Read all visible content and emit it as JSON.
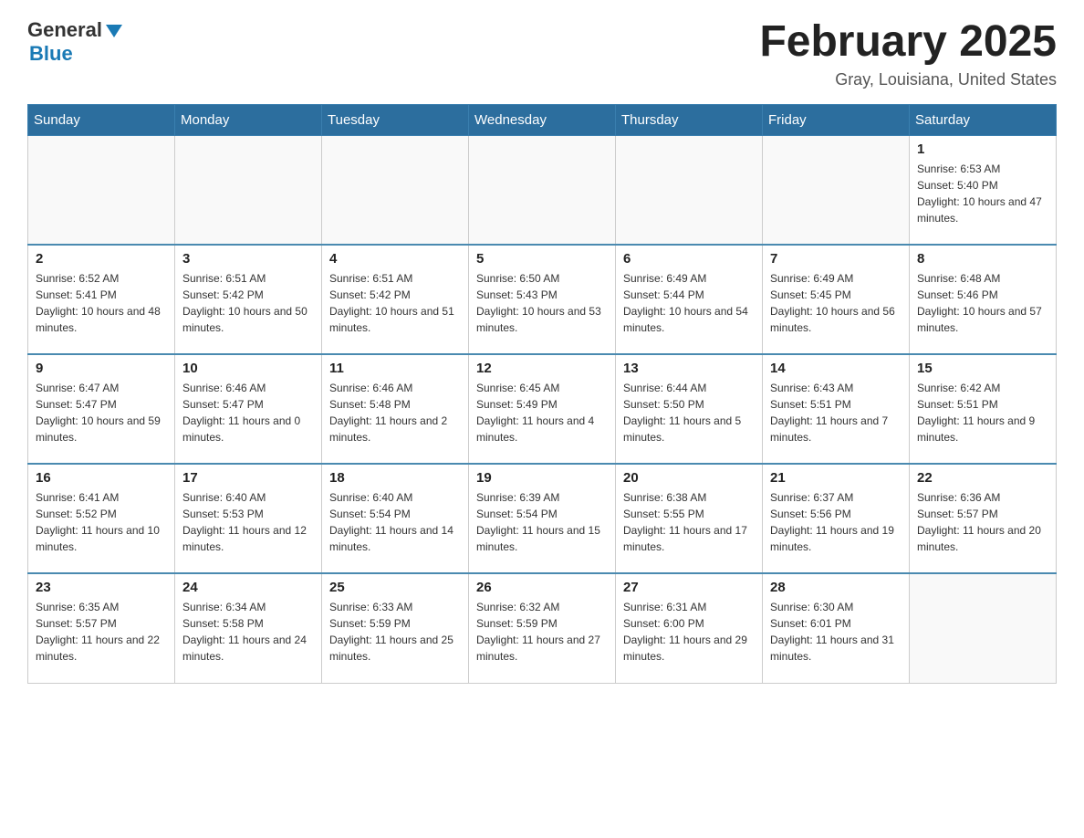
{
  "header": {
    "logo": {
      "general": "General",
      "blue": "Blue",
      "triangle": "▶"
    },
    "title": "February 2025",
    "location": "Gray, Louisiana, United States"
  },
  "calendar": {
    "days_of_week": [
      "Sunday",
      "Monday",
      "Tuesday",
      "Wednesday",
      "Thursday",
      "Friday",
      "Saturday"
    ],
    "weeks": [
      [
        {
          "day": "",
          "info": ""
        },
        {
          "day": "",
          "info": ""
        },
        {
          "day": "",
          "info": ""
        },
        {
          "day": "",
          "info": ""
        },
        {
          "day": "",
          "info": ""
        },
        {
          "day": "",
          "info": ""
        },
        {
          "day": "1",
          "info": "Sunrise: 6:53 AM\nSunset: 5:40 PM\nDaylight: 10 hours and 47 minutes."
        }
      ],
      [
        {
          "day": "2",
          "info": "Sunrise: 6:52 AM\nSunset: 5:41 PM\nDaylight: 10 hours and 48 minutes."
        },
        {
          "day": "3",
          "info": "Sunrise: 6:51 AM\nSunset: 5:42 PM\nDaylight: 10 hours and 50 minutes."
        },
        {
          "day": "4",
          "info": "Sunrise: 6:51 AM\nSunset: 5:42 PM\nDaylight: 10 hours and 51 minutes."
        },
        {
          "day": "5",
          "info": "Sunrise: 6:50 AM\nSunset: 5:43 PM\nDaylight: 10 hours and 53 minutes."
        },
        {
          "day": "6",
          "info": "Sunrise: 6:49 AM\nSunset: 5:44 PM\nDaylight: 10 hours and 54 minutes."
        },
        {
          "day": "7",
          "info": "Sunrise: 6:49 AM\nSunset: 5:45 PM\nDaylight: 10 hours and 56 minutes."
        },
        {
          "day": "8",
          "info": "Sunrise: 6:48 AM\nSunset: 5:46 PM\nDaylight: 10 hours and 57 minutes."
        }
      ],
      [
        {
          "day": "9",
          "info": "Sunrise: 6:47 AM\nSunset: 5:47 PM\nDaylight: 10 hours and 59 minutes."
        },
        {
          "day": "10",
          "info": "Sunrise: 6:46 AM\nSunset: 5:47 PM\nDaylight: 11 hours and 0 minutes."
        },
        {
          "day": "11",
          "info": "Sunrise: 6:46 AM\nSunset: 5:48 PM\nDaylight: 11 hours and 2 minutes."
        },
        {
          "day": "12",
          "info": "Sunrise: 6:45 AM\nSunset: 5:49 PM\nDaylight: 11 hours and 4 minutes."
        },
        {
          "day": "13",
          "info": "Sunrise: 6:44 AM\nSunset: 5:50 PM\nDaylight: 11 hours and 5 minutes."
        },
        {
          "day": "14",
          "info": "Sunrise: 6:43 AM\nSunset: 5:51 PM\nDaylight: 11 hours and 7 minutes."
        },
        {
          "day": "15",
          "info": "Sunrise: 6:42 AM\nSunset: 5:51 PM\nDaylight: 11 hours and 9 minutes."
        }
      ],
      [
        {
          "day": "16",
          "info": "Sunrise: 6:41 AM\nSunset: 5:52 PM\nDaylight: 11 hours and 10 minutes."
        },
        {
          "day": "17",
          "info": "Sunrise: 6:40 AM\nSunset: 5:53 PM\nDaylight: 11 hours and 12 minutes."
        },
        {
          "day": "18",
          "info": "Sunrise: 6:40 AM\nSunset: 5:54 PM\nDaylight: 11 hours and 14 minutes."
        },
        {
          "day": "19",
          "info": "Sunrise: 6:39 AM\nSunset: 5:54 PM\nDaylight: 11 hours and 15 minutes."
        },
        {
          "day": "20",
          "info": "Sunrise: 6:38 AM\nSunset: 5:55 PM\nDaylight: 11 hours and 17 minutes."
        },
        {
          "day": "21",
          "info": "Sunrise: 6:37 AM\nSunset: 5:56 PM\nDaylight: 11 hours and 19 minutes."
        },
        {
          "day": "22",
          "info": "Sunrise: 6:36 AM\nSunset: 5:57 PM\nDaylight: 11 hours and 20 minutes."
        }
      ],
      [
        {
          "day": "23",
          "info": "Sunrise: 6:35 AM\nSunset: 5:57 PM\nDaylight: 11 hours and 22 minutes."
        },
        {
          "day": "24",
          "info": "Sunrise: 6:34 AM\nSunset: 5:58 PM\nDaylight: 11 hours and 24 minutes."
        },
        {
          "day": "25",
          "info": "Sunrise: 6:33 AM\nSunset: 5:59 PM\nDaylight: 11 hours and 25 minutes."
        },
        {
          "day": "26",
          "info": "Sunrise: 6:32 AM\nSunset: 5:59 PM\nDaylight: 11 hours and 27 minutes."
        },
        {
          "day": "27",
          "info": "Sunrise: 6:31 AM\nSunset: 6:00 PM\nDaylight: 11 hours and 29 minutes."
        },
        {
          "day": "28",
          "info": "Sunrise: 6:30 AM\nSunset: 6:01 PM\nDaylight: 11 hours and 31 minutes."
        },
        {
          "day": "",
          "info": ""
        }
      ]
    ]
  }
}
